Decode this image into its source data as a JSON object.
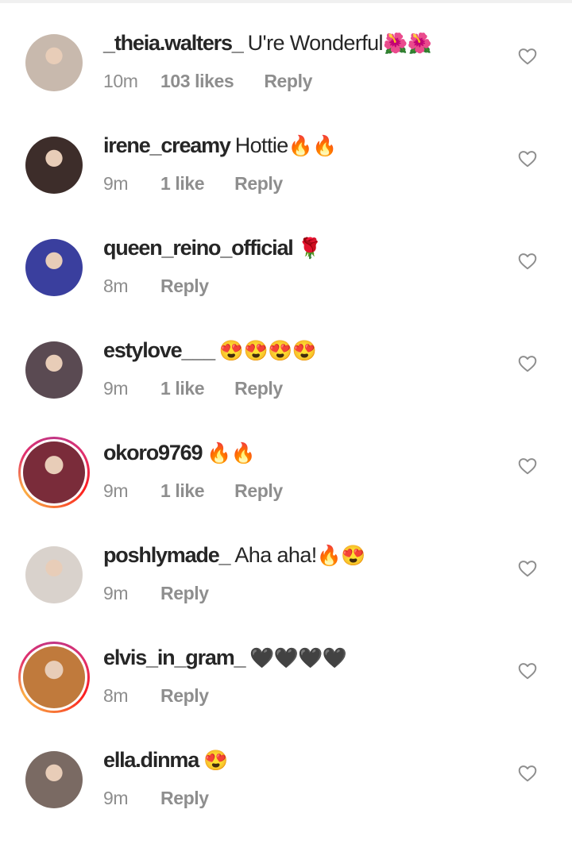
{
  "comments": [
    {
      "username": "_theia.walters_",
      "text": "U're Wonderful",
      "emoji": "🌺🌺",
      "time": "10m",
      "likes": "103 likes",
      "reply": "Reply",
      "ring": false,
      "avatar_color": "#c8b9ad"
    },
    {
      "username": "irene_creamy",
      "text": "Hottie",
      "emoji": "🔥🔥",
      "time": "9m",
      "likes": "1 like",
      "reply": "Reply",
      "ring": false,
      "avatar_color": "#3d2d2a"
    },
    {
      "username": "queen_reino_official",
      "text": "",
      "emoji": "🌹",
      "time": "8m",
      "likes": "",
      "reply": "Reply",
      "ring": false,
      "avatar_color": "#3a3f9e"
    },
    {
      "username": "estylove___",
      "text": "",
      "emoji": "😍😍😍😍",
      "time": "9m",
      "likes": "1 like",
      "reply": "Reply",
      "ring": false,
      "avatar_color": "#5a4a52"
    },
    {
      "username": "okoro9769",
      "text": "",
      "emoji": "🔥🔥",
      "time": "9m",
      "likes": "1 like",
      "reply": "Reply",
      "ring": true,
      "avatar_color": "#7a2c3a"
    },
    {
      "username": "poshlymade_",
      "text": "Aha aha!",
      "emoji": "🔥😍",
      "time": "9m",
      "likes": "",
      "reply": "Reply",
      "ring": false,
      "avatar_color": "#d9d2cc"
    },
    {
      "username": "elvis_in_gram_",
      "text": "",
      "emoji": "🖤🖤🖤🖤",
      "time": "8m",
      "likes": "",
      "reply": "Reply",
      "ring": true,
      "avatar_color": "#c07a3c"
    },
    {
      "username": "ella.dinma",
      "text": "",
      "emoji": "😍",
      "time": "9m",
      "likes": "",
      "reply": "Reply",
      "ring": false,
      "avatar_color": "#7a6a63"
    }
  ],
  "icons": {
    "like": "heart-outline-icon",
    "avatar": "profile-photo"
  }
}
